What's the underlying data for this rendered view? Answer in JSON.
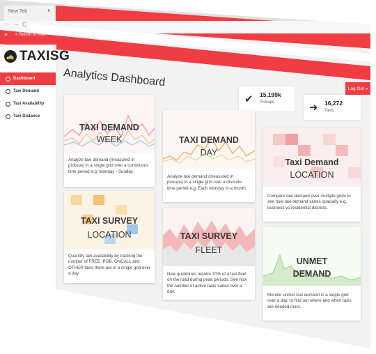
{
  "browser": {
    "tab_title": "New Tab",
    "tab_close": "x",
    "back": "←",
    "forward": "→",
    "reload": "C",
    "star_icon": "☆",
    "menu_icon": "hamburger-icon"
  },
  "app_bar": {
    "menu_glyph": "≡",
    "back_label": "< Return to main"
  },
  "brand": {
    "name": "TAXISG",
    "accent_color": "#ef3d43"
  },
  "sidebar": {
    "items": [
      {
        "label": "Dashboard",
        "active": true
      },
      {
        "label": "Taxi Demand",
        "active": false
      },
      {
        "label": "Taxi Availability",
        "active": false
      },
      {
        "label": "Taxi Distance",
        "active": false
      }
    ]
  },
  "header": {
    "title": "Analytics Dashboard",
    "logout_label": "Log Out »"
  },
  "stats": {
    "pickups": {
      "value": "15,199k",
      "label": "Pickups",
      "icon": "check-circle-icon"
    },
    "taxis": {
      "value": "16,272",
      "label": "Taxis",
      "icon": "arrow-right-icon"
    }
  },
  "cards": [
    {
      "title": "TAXI DEMAND",
      "subtitle": "WEEK",
      "description": "Analyze taxi demand (measured in pickups) in a single grid over a continuous time period e.g. Monday - Sunday."
    },
    {
      "title": "TAXI DEMAND",
      "subtitle": "DAY",
      "description": "Analyze taxi demand (measured in pickups) in a single grid over a discrete time period e.g. Each Monday in a month."
    },
    {
      "title": "Taxi Demand",
      "subtitle": "LOCATION",
      "description": "Compare taxi demand over multiple grids to see how taxi demand varies spacially e.g. business vs residential districts."
    },
    {
      "title": "TAXI SURVEY",
      "subtitle": "LOCATION",
      "description": "Quantify taxi availability by tracking the number of FREE, POB, ONCALL and OTHER taxis there are in a single grid over a day."
    },
    {
      "title": "TAXI SURVEY",
      "subtitle": "FLEET",
      "description": "New guidelines require 70% of a taxi fleet on the road during peak periods. See how the number of active taxis varies over a day."
    },
    {
      "title": "UNMET",
      "subtitle": "DEMAND",
      "description": "Monitor unmet taxi demand in a single grid over a day, to find out where and when taxis are needed most."
    }
  ]
}
